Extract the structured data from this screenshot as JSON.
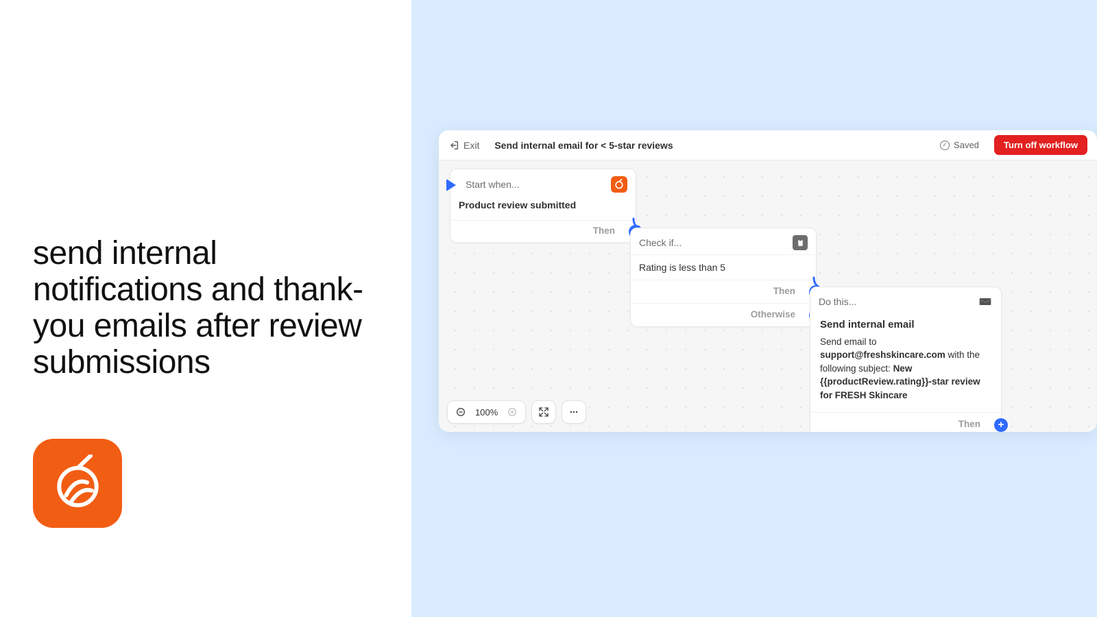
{
  "left": {
    "headline": "send internal notifications and thank-you emails after review submissions"
  },
  "app": {
    "header": {
      "exit_label": "Exit",
      "title": "Send internal email for < 5-star reviews",
      "saved_label": "Saved",
      "turnoff_label": "Turn off workflow"
    },
    "cards": {
      "trigger": {
        "header_label": "Start when...",
        "body": "Product review submitted",
        "then_label": "Then"
      },
      "condition": {
        "header_label": "Check if...",
        "body": "Rating is less than 5",
        "then_label": "Then",
        "otherwise_label": "Otherwise"
      },
      "action": {
        "header_label": "Do this...",
        "title": "Send internal email",
        "prefix": "Send email to ",
        "email": "support@freshskincare.com",
        "middle": " with the following subject: ",
        "subject": "New {{productReview.rating}}-star review for FRESH Skincare",
        "then_label": "Then"
      }
    },
    "zoombar": {
      "level": "100%"
    }
  }
}
